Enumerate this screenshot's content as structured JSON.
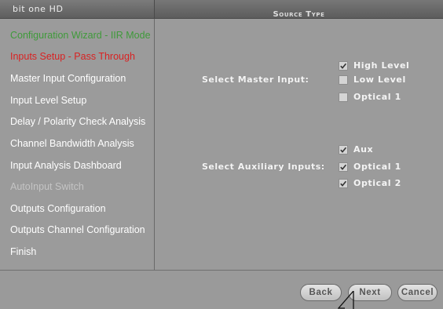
{
  "header": {
    "app_title": "bit one HD",
    "section_title": "Source Type"
  },
  "sidebar": {
    "items": [
      {
        "label": "Configuration Wizard - IIR Mode",
        "state": "active"
      },
      {
        "label": "Inputs Setup - Pass Through",
        "state": "current"
      },
      {
        "label": "Master Input Configuration",
        "state": "normal"
      },
      {
        "label": "Input Level Setup",
        "state": "normal"
      },
      {
        "label": "Delay / Polarity Check Analysis",
        "state": "normal"
      },
      {
        "label": "Channel Bandwidth Analysis",
        "state": "normal"
      },
      {
        "label": "Input Analysis Dashboard",
        "state": "normal"
      },
      {
        "label": "AutoInput Switch",
        "state": "disabled"
      },
      {
        "label": "Outputs Configuration",
        "state": "normal"
      },
      {
        "label": "Outputs Channel Configuration",
        "state": "normal"
      },
      {
        "label": "Finish",
        "state": "normal"
      }
    ]
  },
  "master_input": {
    "label": "Select Master Input:",
    "options": [
      {
        "label": "High Level",
        "checked": true
      },
      {
        "label": "Low Level",
        "checked": false
      },
      {
        "label": "Optical 1",
        "checked": false
      }
    ]
  },
  "auxiliary_inputs": {
    "label": "Select Auxiliary Inputs:",
    "options": [
      {
        "label": "Aux",
        "checked": true
      },
      {
        "label": "Optical 1",
        "checked": true
      },
      {
        "label": "Optical 2",
        "checked": true
      }
    ]
  },
  "footer": {
    "back_label": "Back",
    "next_label": "Next",
    "cancel_label": "Cancel"
  },
  "colors": {
    "background": "#9b9b9b",
    "active_item": "#3f9a3a",
    "current_item": "#d92222",
    "disabled_item": "#c4c4c4"
  }
}
